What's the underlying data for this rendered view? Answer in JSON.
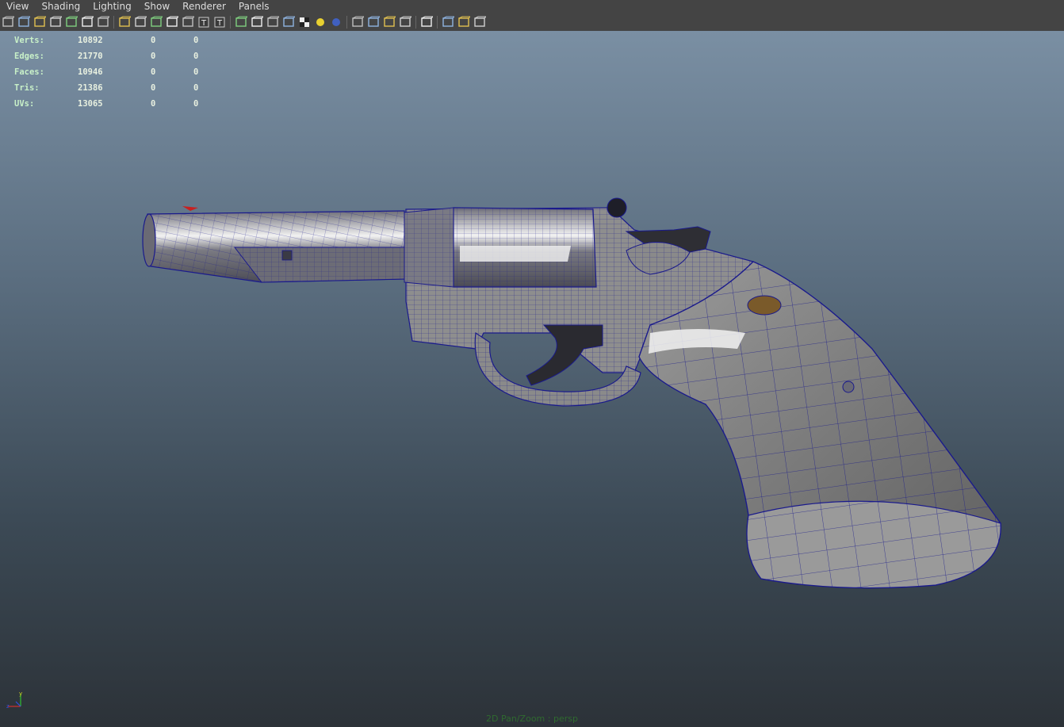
{
  "menu": [
    "View",
    "Shading",
    "Lighting",
    "Show",
    "Renderer",
    "Panels"
  ],
  "toolbar_icons": [
    "camera-icon",
    "camera-attributes-icon",
    "bookmark-icon",
    "image-plane-icon",
    "grid-icon",
    "film-gate-icon",
    "resolution-gate-icon",
    "sep",
    "wireframe-icon",
    "smooth-shade-icon",
    "sphere-shade-icon",
    "flat-shade-icon",
    "bounding-box-icon",
    "textured-icon",
    "text-icon",
    "sep",
    "wire-on-shaded-icon",
    "xray-icon",
    "xray-joints-icon",
    "xray-components-icon",
    "checker-icon",
    "use-lights-icon",
    "shadows-icon",
    "sep",
    "ambient-occlusion-icon",
    "motion-blur-icon",
    "anti-alias-icon",
    "depth-of-field-icon",
    "sep",
    "isolate-select-icon",
    "sep",
    "single-view-icon",
    "four-view-icon",
    "node-editor-icon"
  ],
  "hud": {
    "rows": [
      {
        "label": "Verts:",
        "v1": "10892",
        "v2": "0",
        "v3": "0"
      },
      {
        "label": "Edges:",
        "v1": "21770",
        "v2": "0",
        "v3": "0"
      },
      {
        "label": "Faces:",
        "v1": "10946",
        "v2": "0",
        "v3": "0"
      },
      {
        "label": "Tris:",
        "v1": "21386",
        "v2": "0",
        "v3": "0"
      },
      {
        "label": "UVs:",
        "v1": "13065",
        "v2": "0",
        "v3": "0"
      }
    ]
  },
  "camera_label": "2D Pan/Zoom : persp",
  "colors": {
    "wire": "#1a1a8c",
    "mesh": "#8a8a8a",
    "mesh_dark": "#3c3c3c",
    "highlight": "#f4f4f4"
  }
}
